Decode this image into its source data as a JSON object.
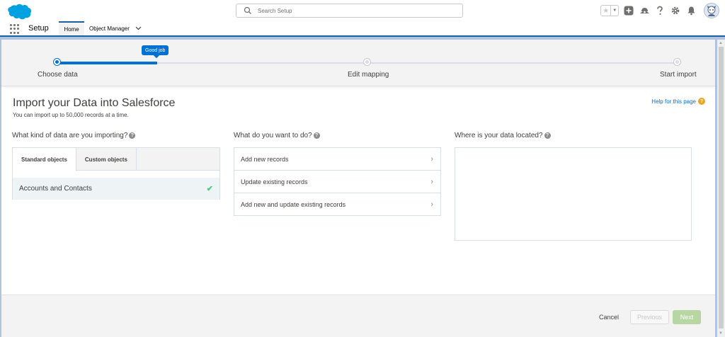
{
  "header": {
    "search_placeholder": "Search Setup",
    "favorites_star": "★",
    "favorites_dropdown": "▼",
    "icons": [
      "plus-icon",
      "trailhead-icon",
      "help-icon",
      "gear-icon",
      "bell-icon",
      "avatar"
    ]
  },
  "nav": {
    "app_name": "Setup",
    "tabs": [
      {
        "label": "Home",
        "active": true
      },
      {
        "label": "Object Manager",
        "active": false
      }
    ]
  },
  "progress": {
    "tooltip": "Good job",
    "steps": [
      {
        "label": "Choose data",
        "state": "complete"
      },
      {
        "label": "Edit mapping",
        "state": "pending"
      },
      {
        "label": "Start import",
        "state": "pending"
      }
    ]
  },
  "page": {
    "title": "Import your Data into Salesforce",
    "subtitle": "You can import up to 50,000 records at a time.",
    "help_link": "Help for this page"
  },
  "columns": {
    "data_kind": {
      "heading": "What kind of data are you importing?",
      "tabs": [
        "Standard objects",
        "Custom objects"
      ],
      "items": [
        {
          "label": "Accounts and Contacts",
          "selected": true
        }
      ]
    },
    "action": {
      "heading": "What do you want to do?",
      "items": [
        "Add new records",
        "Update existing records",
        "Add new and update existing records"
      ]
    },
    "location": {
      "heading": "Where is your data located?"
    }
  },
  "footer": {
    "cancel": "Cancel",
    "previous": "Previous",
    "next": "Next"
  },
  "colors": {
    "brand_blue": "#0070d2",
    "next_disabled": "#b7d6a3",
    "help_icon": "#e8a522",
    "selected_row": "#eef4f6",
    "check": "#4bca81"
  }
}
